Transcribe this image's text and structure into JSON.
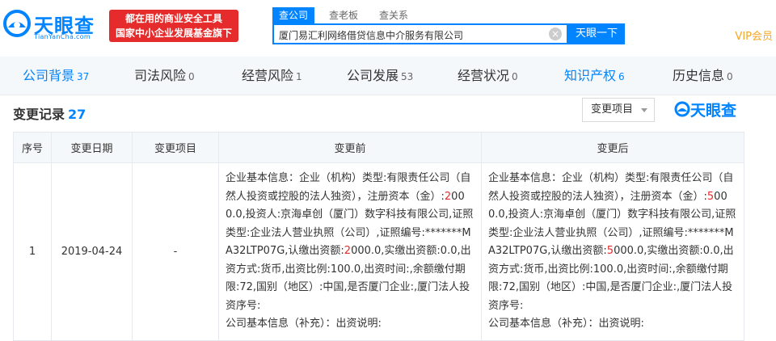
{
  "header": {
    "logo_text": "天眼查",
    "logo_sub": "TianYanCha.com",
    "slogan_line1": "都在用的商业安全工具",
    "slogan_line2": "国家中小企业发展基金旗下",
    "search_tabs": [
      "查公司",
      "查老板",
      "查关系"
    ],
    "search_value": "厦门易汇利网络借贷信息中介服务有限公司",
    "search_button": "天眼一下",
    "vip": "VIP会员",
    "clear_icon": "×"
  },
  "nav": {
    "items": [
      {
        "label": "公司背景",
        "count": "37"
      },
      {
        "label": "司法风险",
        "count": "0"
      },
      {
        "label": "经营风险",
        "count": "1"
      },
      {
        "label": "公司发展",
        "count": "53"
      },
      {
        "label": "经营状况",
        "count": "0"
      },
      {
        "label": "知识产权",
        "count": "6"
      },
      {
        "label": "历史信息",
        "count": "0"
      }
    ]
  },
  "section": {
    "title": "变更记录",
    "count": "27",
    "filter_label": "变更项目",
    "watermark": "天眼查"
  },
  "table": {
    "headers": [
      "序号",
      "变更日期",
      "变更项目",
      "变更前",
      "变更后"
    ],
    "rows": [
      {
        "index": "1",
        "date": "2019-04-24",
        "item": "-",
        "before_a": "企业基本信息：企业（机构）类型:有限责任公司（自然人投资或控股的法人独资），注册资本（金）:",
        "before_hl1": "2",
        "before_b": "000.0,投资人:京海卓创（厦门）数字科技有限公司,证照类型:企业法人营业执照（公司）,证照编号:*******MA32LTP07G,认缴出资额:",
        "before_hl2": "2",
        "before_c": "000.0,实缴出资额:0.0,出资方式:货币,出资比例:100.0,出资时间:,余额缴付期限:72,国别（地区）:中国,是否厦门企业:,厦门法人投资序号:",
        "before_d": "公司基本信息（补充）：出资说明:",
        "after_a": "企业基本信息：企业（机构）类型:有限责任公司（自然人投资或控股的法人独资），注册资本（金）:",
        "after_hl1": "5",
        "after_b": "000.0,投资人:京海卓创（厦门）数字科技有限公司,证照类型:企业法人营业执照（公司）,证照编号:*******MA32LTP07G,认缴出资额:",
        "after_hl2": "5",
        "after_c": "000.0,实缴出资额:0.0,出资方式:货币,出资比例:100.0,出资时间:,余额缴付期限:72,国别（地区）:中国,是否厦门企业:,厦门法人投资序号:",
        "after_d": "公司基本信息（补充）：出资说明:"
      }
    ]
  },
  "colors": {
    "brand_blue": "#0084ff",
    "slogan_red": "#e52b2b",
    "vip_gold": "#f5a623"
  }
}
